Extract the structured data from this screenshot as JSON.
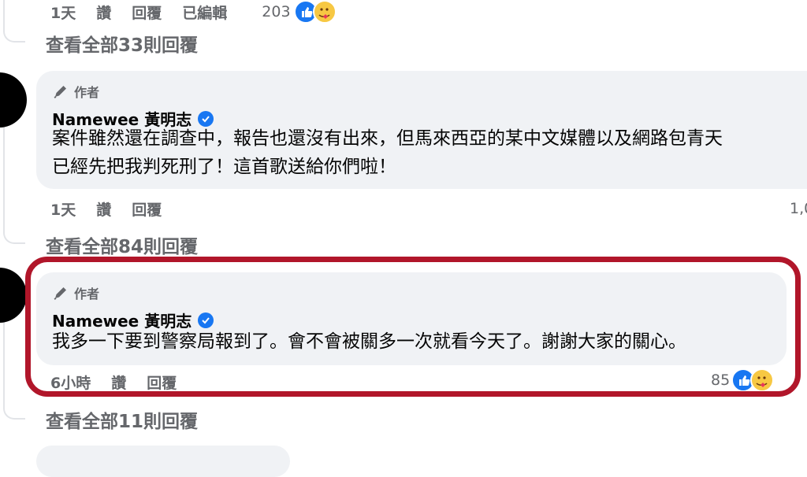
{
  "comment_top": {
    "time": "1天",
    "like_label": "讚",
    "reply_label": "回覆",
    "edited_label": "已編輯",
    "reaction_count": "203",
    "view_replies": "查看全部33則回覆"
  },
  "comment_1": {
    "author_tag": "作者",
    "name": "Namewee 黃明志",
    "line1": "案件雖然還在調查中，報告也還沒有出來，但馬來西亞的某中文媒體以及網路包青天",
    "line2": "已經先把我判死刑了！這首歌送給你們啦！",
    "time": "1天",
    "like_label": "讚",
    "reply_label": "回覆",
    "reaction_count": "1,0",
    "view_replies": "查看全部84則回覆"
  },
  "comment_2": {
    "author_tag": "作者",
    "name": "Namewee 黃明志",
    "line1": "我多一下要到警察局報到了。會不會被關多一次就看今天了。謝謝大家的關心。",
    "time": "6小時",
    "like_label": "讚",
    "reply_label": "回覆",
    "reaction_count": "85",
    "view_replies": "查看全部11則回覆"
  },
  "colors": {
    "highlight": "#b1162a",
    "bubble": "#f0f2f5",
    "facebook_blue": "#1877f2",
    "secondary_text": "#65676b"
  }
}
